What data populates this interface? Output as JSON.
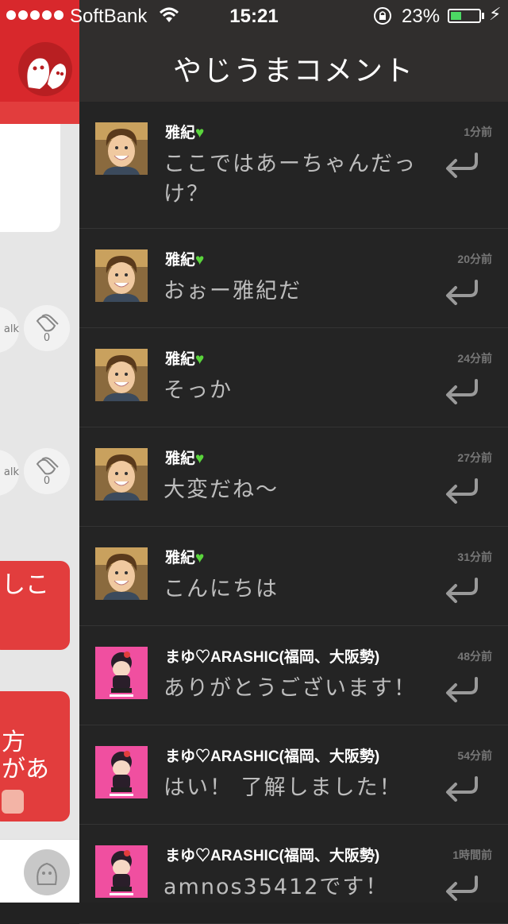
{
  "status_bar": {
    "carrier": "SoftBank",
    "time": "15:21",
    "battery": "23%",
    "battery_level": 0.23
  },
  "left_panel": {
    "talk_fragment": "alk",
    "clap_count_1": "0",
    "clap_count_2": "0",
    "bubble_1": "しこ",
    "bubble_2": "方\nがあ"
  },
  "header": {
    "title": "やじうまコメント"
  },
  "comments": [
    {
      "name": "雅紀💚",
      "time": "1分前",
      "message": "ここではあーちゃんだっけ？",
      "avatar": "man"
    },
    {
      "name": "雅紀💚",
      "time": "20分前",
      "message": "おぉー雅紀だ",
      "avatar": "man"
    },
    {
      "name": "雅紀💚",
      "time": "24分前",
      "message": "そっか",
      "avatar": "man"
    },
    {
      "name": "雅紀💚",
      "time": "27分前",
      "message": "大変だね〜",
      "avatar": "man"
    },
    {
      "name": "雅紀💚",
      "time": "31分前",
      "message": "こんにちは",
      "avatar": "man"
    },
    {
      "name": "まゆ♡ARASHIC(福岡、大阪勢)",
      "time": "48分前",
      "message": "ありがとうございます！",
      "avatar": "doll"
    },
    {
      "name": "まゆ♡ARASHIC(福岡、大阪勢)",
      "time": "54分前",
      "message": "はい！ 了解しました！",
      "avatar": "doll"
    },
    {
      "name": "まゆ♡ARASHIC(福岡、大阪勢)",
      "time": "1時間前",
      "message": "amnos35412です！",
      "avatar": "doll"
    }
  ],
  "colors": {
    "brand_red": "#d8282c",
    "panel_bg": "#242424",
    "header_bg": "#302e2d",
    "heart": "#5ad43c"
  },
  "icons": {
    "reply": "reply-arrow-icon",
    "wifi": "wifi-icon",
    "lock": "rotation-lock-icon",
    "bolt": "charging-bolt-icon"
  }
}
